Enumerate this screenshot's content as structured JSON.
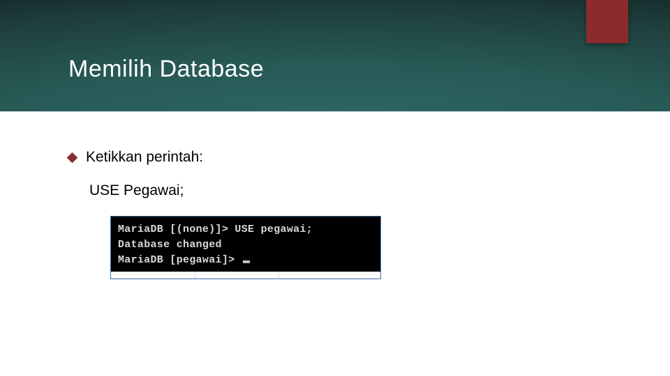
{
  "slide": {
    "title": "Memilih Database",
    "bullet": "Ketikkan perintah:",
    "command": "USE Pegawai;",
    "terminal": {
      "line1": "MariaDB [(none)]> USE pegawai;",
      "line2": "Database changed",
      "line3": "MariaDB [pegawai]>"
    }
  },
  "colors": {
    "accent": "#8c2b2b"
  }
}
